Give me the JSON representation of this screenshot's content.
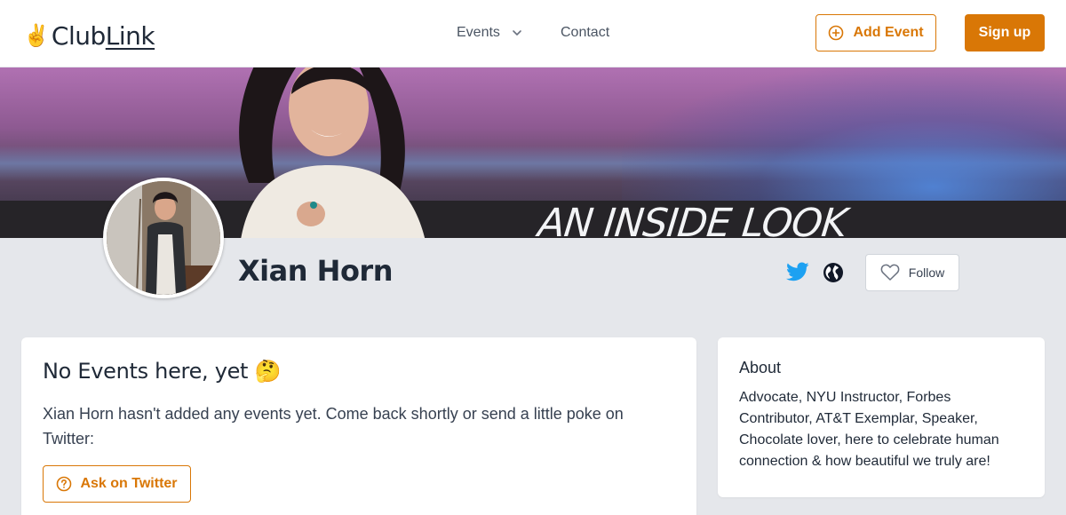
{
  "header": {
    "logo_prefix": "Club",
    "logo_suffix": "Link",
    "logo_icon": "victory-hand-icon",
    "nav": {
      "events_label": "Events",
      "contact_label": "Contact"
    },
    "add_event_label": "Add Event",
    "signup_label": "Sign up"
  },
  "banner": {
    "caption": "AN INSIDE LOOK"
  },
  "profile": {
    "name": "Xian Horn",
    "social": [
      "twitter-icon",
      "globe-icon"
    ],
    "follow_label": "Follow"
  },
  "events": {
    "title": "No Events here, yet",
    "emoji": "🤔",
    "message": "Xian Horn hasn't added any events yet. Come back shortly or send a little poke on Twitter:",
    "ask_label": "Ask on Twitter"
  },
  "about": {
    "title": "About",
    "text": "Advocate, NYU Instructor, Forbes Contributor, AT&T Exemplar, Speaker, Chocolate lover, here to celebrate human connection & how beautiful we truly are!"
  },
  "colors": {
    "accent": "#d97706",
    "twitter": "#1da1f2",
    "page_bg": "#e5e7eb"
  }
}
